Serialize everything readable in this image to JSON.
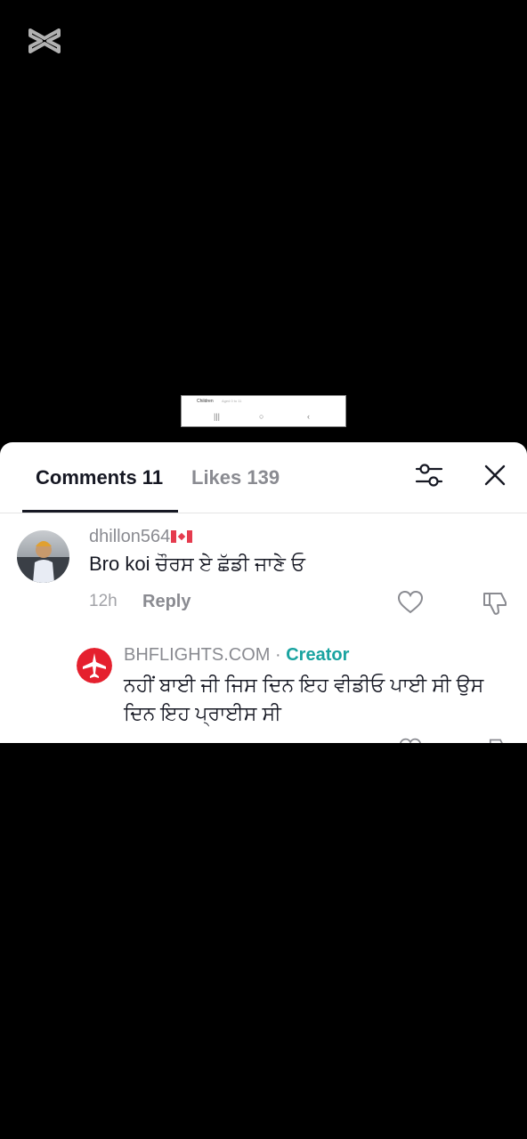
{
  "app": {
    "logo_icon": "capcut-logo-icon"
  },
  "thumbnail": {
    "title": "Children",
    "subtitle": "Aged 0 to 11"
  },
  "comments_panel": {
    "tabs": [
      {
        "label": "Comments 11",
        "active": true
      },
      {
        "label": "Likes 139",
        "active": false
      }
    ],
    "filter_icon": "filter-sliders-icon",
    "close_icon": "close-icon",
    "comments": [
      {
        "username": "dhillon564",
        "flag_icon": "canada-flag-icon",
        "text": "Bro koi ਚੌਰਸ ਏ ਛੱਡੀ ਜਾਣੇ ਓ",
        "time": "12h",
        "reply_label": "Reply"
      }
    ],
    "replies": [
      {
        "username": "BHFLIGHTS.COM",
        "separator": " · ",
        "badge": "Creator",
        "text": "ਨਹੀਂ ਬਾਈ ਜੀ ਜਿਸ ਦਿਨ ਇਹ ਵੀਡੀਓ ਪਾਈ ਸੀ ਉਸ ਦਿਨ ਇਹ ਪ੍ਰਾਈਸ ਸੀ"
      }
    ]
  },
  "colors": {
    "creator_badge": "#19a3a0",
    "brand_red": "#e5202e",
    "text_primary": "#161823",
    "text_secondary": "#8a8b91"
  }
}
